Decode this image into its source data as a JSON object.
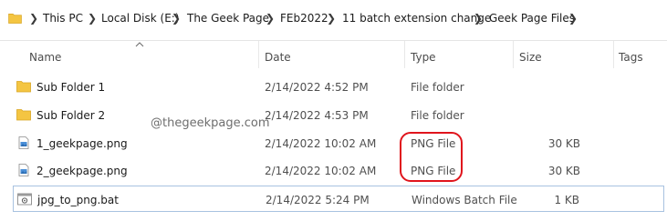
{
  "breadcrumb": {
    "items": [
      "This PC",
      "Local Disk (E:)",
      "The Geek Page",
      "FEb2022",
      "11 batch extension change",
      "Geek Page Files"
    ]
  },
  "columns": {
    "name": "Name",
    "date": "Date",
    "type": "Type",
    "size": "Size",
    "tags": "Tags"
  },
  "files": [
    {
      "name": "Sub Folder 1",
      "date": "2/14/2022 4:52 PM",
      "type": "File folder",
      "size": "",
      "icon": "folder-icon"
    },
    {
      "name": "Sub Folder 2",
      "date": "2/14/2022 4:53 PM",
      "type": "File folder",
      "size": "",
      "icon": "folder-icon"
    },
    {
      "name": "1_geekpage.png",
      "date": "2/14/2022 10:02 AM",
      "type": "PNG File",
      "size": "30 KB",
      "icon": "png-file-icon"
    },
    {
      "name": "2_geekpage.png",
      "date": "2/14/2022 10:02 AM",
      "type": "PNG File",
      "size": "30 KB",
      "icon": "png-file-icon"
    },
    {
      "name": "jpg_to_png.bat",
      "date": "2/14/2022 5:24 PM",
      "type": "Windows Batch File",
      "size": "1 KB",
      "icon": "batch-file-icon"
    }
  ],
  "watermark": "@thegeekpage.com",
  "colors": {
    "folder": "#f4c542",
    "annotation": "#e0141c",
    "selection_border": "#a8c2e0"
  }
}
